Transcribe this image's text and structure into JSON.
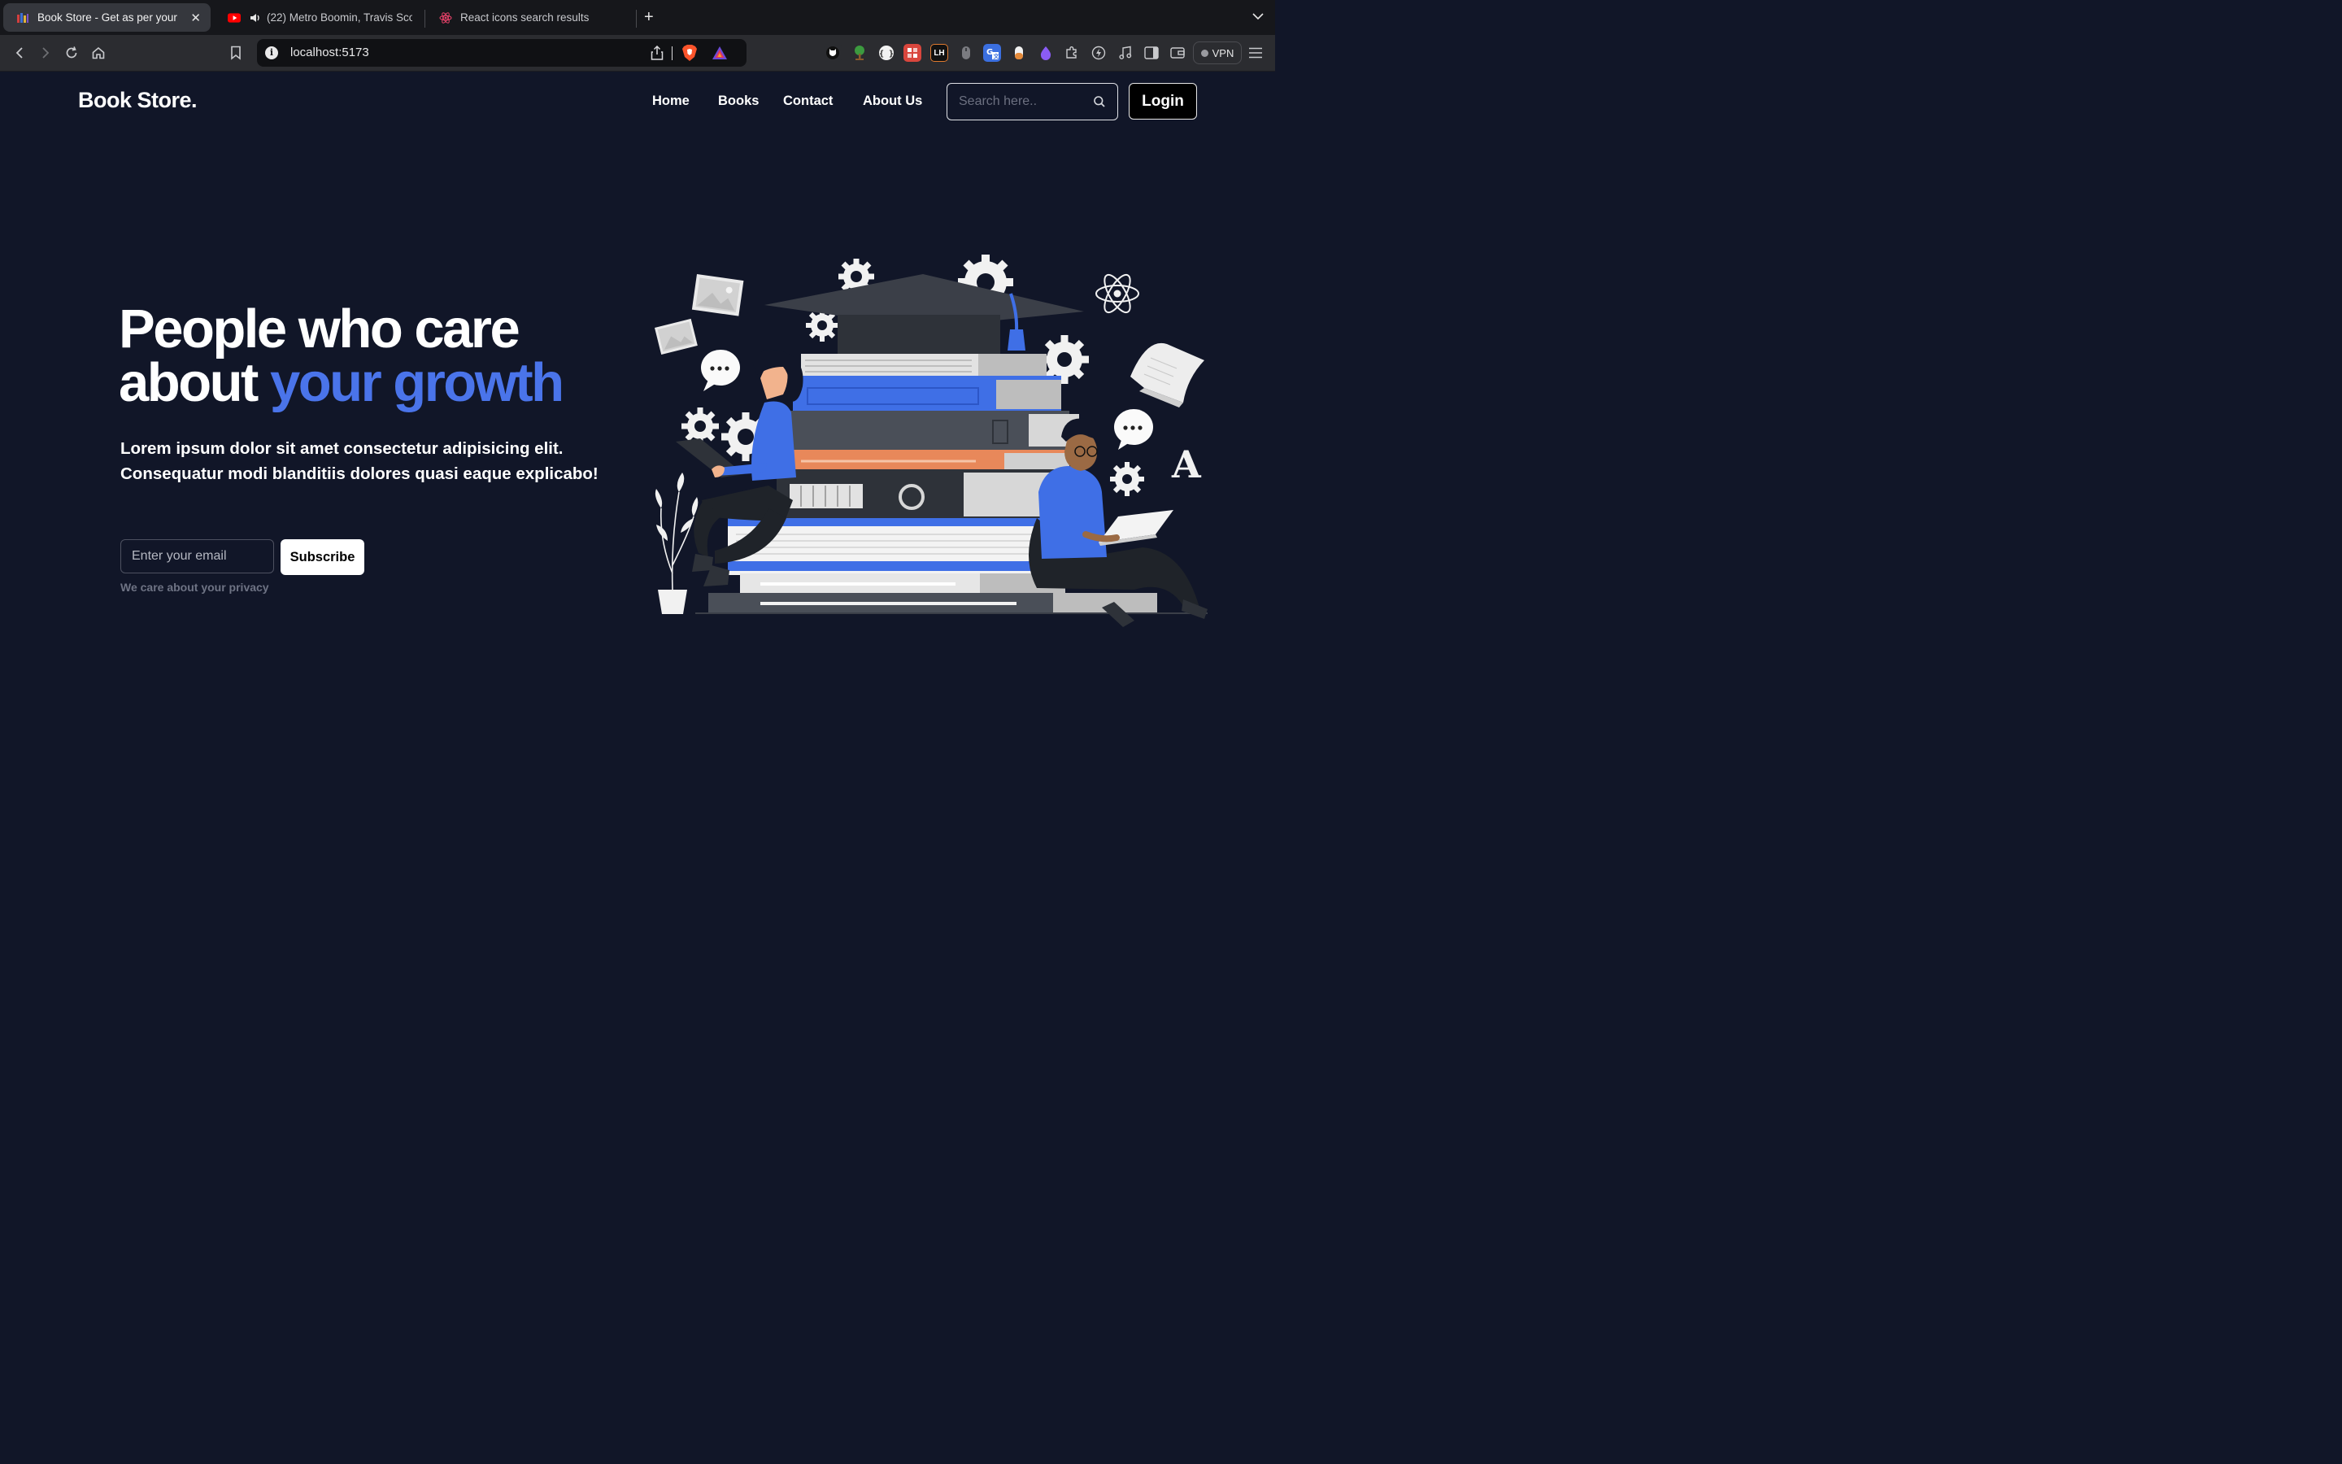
{
  "browser": {
    "tabs": [
      {
        "title": "Book Store - Get as per your",
        "active": true
      },
      {
        "title": "(22) Metro Boomin, Travis Sco",
        "active": false
      },
      {
        "title": "React icons search results",
        "active": false
      }
    ],
    "address": "localhost:5173",
    "vpn_label": "VPN",
    "extension_labels": {
      "lh": "LH"
    }
  },
  "header": {
    "brand": "Book Store.",
    "nav": [
      "Home",
      "Books",
      "Contact",
      "About Us"
    ],
    "search_placeholder": "Search here..",
    "login_label": "Login"
  },
  "hero": {
    "line1": "People who care",
    "line2_plain": "about ",
    "line2_accent": "your growth",
    "paragraph": "Lorem ipsum dolor sit amet consectetur adipisicing elit. Consequatur modi blanditiis dolores quasi eaque explicabo!",
    "email_placeholder": "Enter your email",
    "subscribe_label": "Subscribe",
    "privacy_note": "We care about your privacy"
  },
  "colors": {
    "page_bg": "#111628",
    "accent": "#4a74ea",
    "chrome_bg": "#16171b"
  },
  "icons": [
    "back-icon",
    "forward-icon",
    "reload-icon",
    "home-icon",
    "bookmark-icon",
    "share-icon",
    "brave-shield-icon",
    "rewards-icon",
    "search-icon",
    "menu-icon",
    "tab-list-icon",
    "close-icon"
  ]
}
